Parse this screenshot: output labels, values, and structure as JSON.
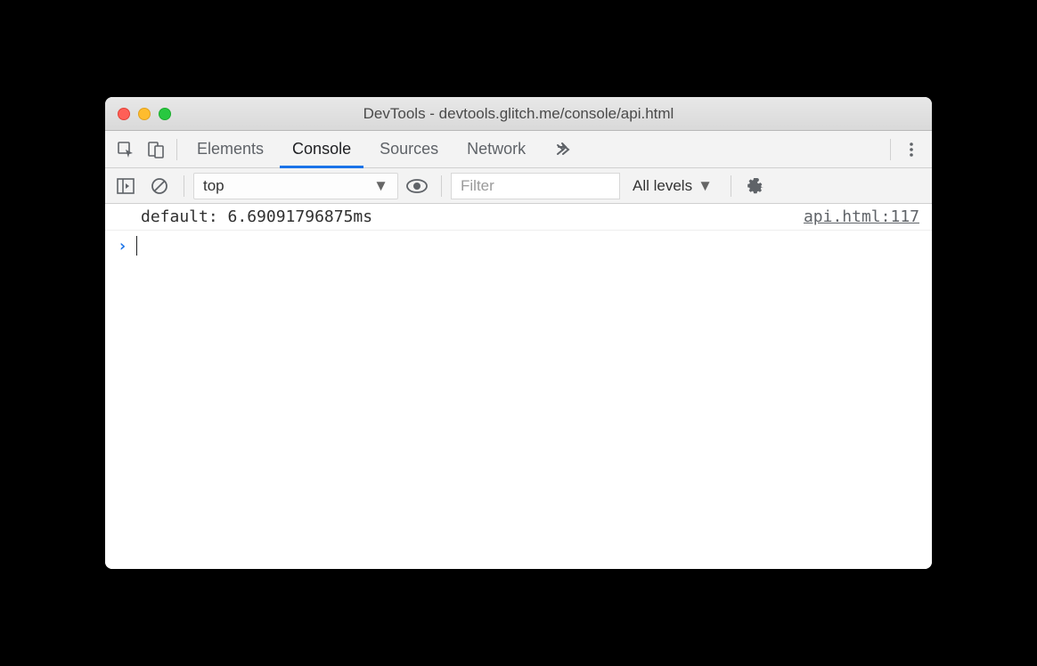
{
  "window": {
    "title": "DevTools - devtools.glitch.me/console/api.html"
  },
  "tabs": {
    "elements": "Elements",
    "console": "Console",
    "sources": "Sources",
    "network": "Network"
  },
  "subbar": {
    "context": "top",
    "filter_placeholder": "Filter",
    "levels": "All levels"
  },
  "log": {
    "message": "default: 6.69091796875ms",
    "source": "api.html:117"
  }
}
